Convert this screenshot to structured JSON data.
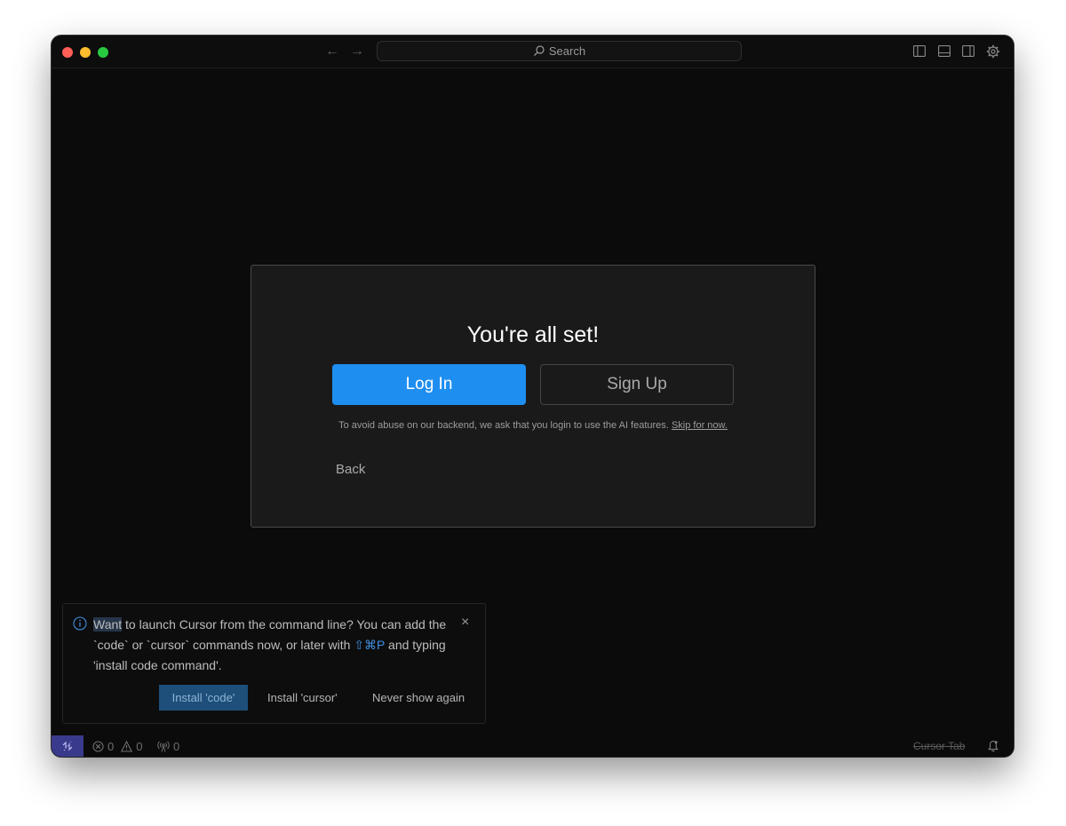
{
  "titlebar": {
    "search_label": "Search",
    "back_arrow": "←",
    "forward_arrow": "→"
  },
  "dialog": {
    "title": "You're all set!",
    "login_label": "Log In",
    "signup_label": "Sign Up",
    "notice_text": "To avoid abuse on our backend, we ask that you login to use the AI features.",
    "skip_label": "Skip for now.",
    "back_label": "Back"
  },
  "toast": {
    "msg_highlight": "Want",
    "msg_part1": " to launch Cursor from the command line? You can add the `code` or `cursor` commands now, or later with ",
    "shortcut": "⇧⌘P",
    "msg_part2": " and typing 'install code command'.",
    "close_glyph": "×",
    "install_code_label": "Install 'code'",
    "install_cursor_label": "Install 'cursor'",
    "never_show_label": "Never show again"
  },
  "statusbar": {
    "errors_count": "0",
    "warnings_count": "0",
    "ports_count": "0",
    "cursor_tab_label": "Cursor Tab"
  },
  "colors": {
    "accent": "#1f8ef1",
    "window_bg": "#0b0b0b",
    "dialog_bg": "#1a1a1a",
    "remote_bg": "#3a3a8c"
  },
  "icons": {
    "search": "search-icon",
    "sidebar_toggle": "toggle-primary-sidebar-icon",
    "panel_toggle": "toggle-panel-icon",
    "secondary_sidebar": "toggle-secondary-sidebar-icon",
    "settings": "gear-icon",
    "info": "info-icon",
    "remote": "remote-indicator-icon",
    "errors": "error-icon",
    "warnings": "warning-icon",
    "ports": "broadcast-icon",
    "bell": "bell-icon"
  }
}
